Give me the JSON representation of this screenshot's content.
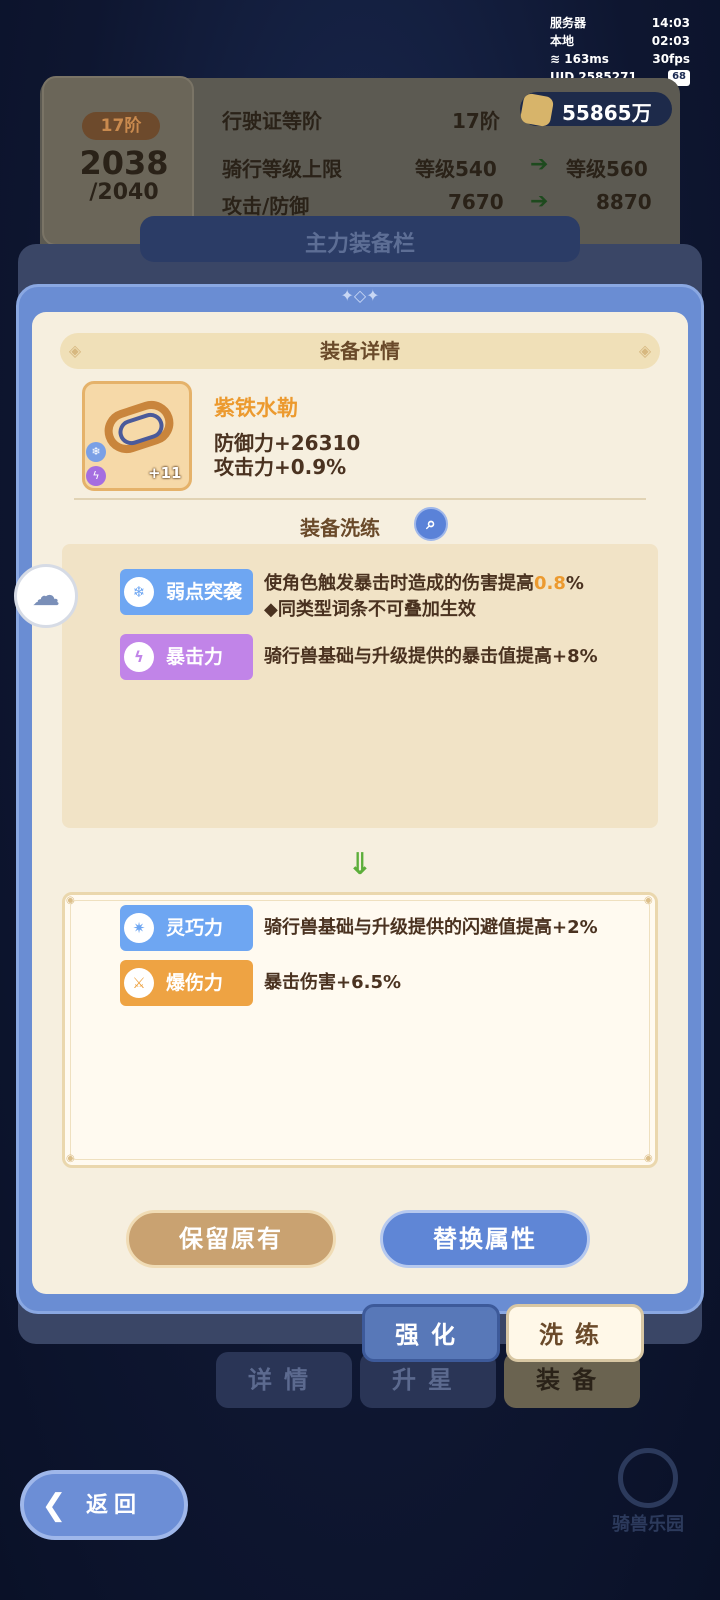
{
  "hud": {
    "server_label": "服务器",
    "server_time": "14:03",
    "local_label": "本地",
    "local_time": "02:03",
    "ping": "163ms",
    "fps": "30fps",
    "uid_label": "UID 2585271",
    "battery": "68"
  },
  "currency": {
    "amount": "55865万"
  },
  "license_panel": {
    "tier_badge": "17阶",
    "progress_value": "2038",
    "progress_max": "/2040",
    "rows": [
      {
        "label": "行驶证等阶",
        "current": "17阶",
        "next": ""
      },
      {
        "label": "骑行等级上限",
        "current": "等级540",
        "next": "等级560"
      },
      {
        "label": "攻击/防御",
        "current": "7670",
        "next": "8870"
      }
    ]
  },
  "background_bar_title": "主力装备栏",
  "dialog": {
    "title": "装备详情",
    "item": {
      "name": "紫铁水勒",
      "level": "+11",
      "stats": [
        "防御力+26310",
        "攻击力+0.9%"
      ]
    },
    "refine_title": "装备洗练",
    "current_attributes": [
      {
        "tag": "弱点突袭",
        "color": "#6ea6f2",
        "icon": "crystal-icon",
        "desc_line1_prefix": "使角色触发暴击时造成的伤害提高",
        "desc_line1_highlight": "0.8",
        "desc_line1_suffix": "%",
        "desc_line2": "◆同类型词条不可叠加生效"
      },
      {
        "tag": "暴击力",
        "color": "#c184e8",
        "icon": "lightning-icon",
        "desc_line1_prefix": "骑行兽基础与升级提供的暴击值提高+8%",
        "desc_line1_highlight": "",
        "desc_line1_suffix": "",
        "desc_line2": ""
      }
    ],
    "new_attributes": [
      {
        "tag": "灵巧力",
        "color": "#6ea6f2",
        "icon": "star-icon",
        "desc": "骑行兽基础与升级提供的闪避值提高+2%"
      },
      {
        "tag": "爆伤力",
        "color": "#eea343",
        "icon": "crossed-swords-icon",
        "desc": "暴击伤害+6.5%"
      }
    ],
    "keep_button": "保留原有",
    "replace_button": "替换属性"
  },
  "subtabs": {
    "enhance": "强化",
    "refine": "洗练"
  },
  "main_tabs": {
    "details": "详情",
    "star_up": "升星",
    "equip": "装备"
  },
  "back_button": "返回",
  "brand": "骑兽乐园"
}
